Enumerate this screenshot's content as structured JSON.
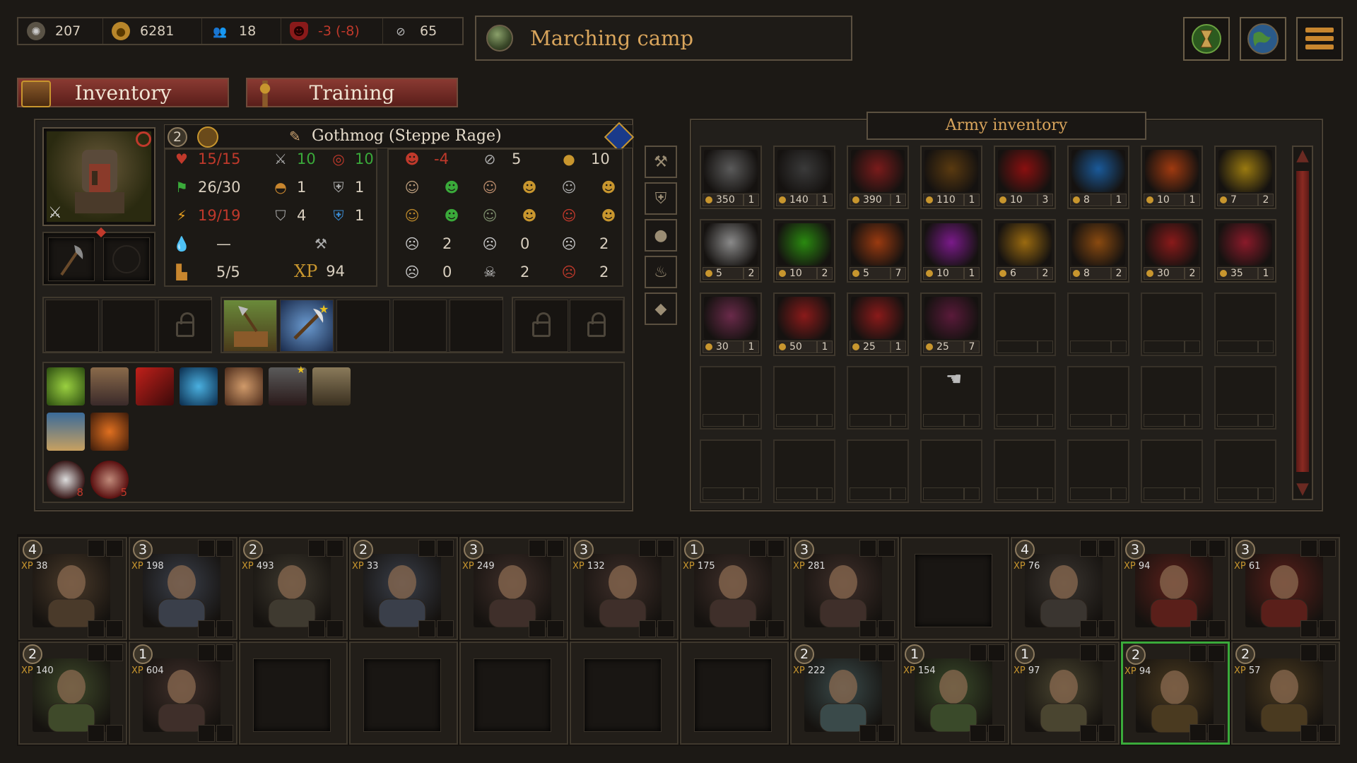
{
  "resources": [
    {
      "icon": "gear-icon",
      "value": "207",
      "color": "#d9cfbf"
    },
    {
      "icon": "gold-coins-icon",
      "value": "6281",
      "color": "#d9cfbf"
    },
    {
      "icon": "people-icon",
      "value": "18",
      "color": "#d9cfbf"
    },
    {
      "icon": "mask-icon",
      "value": "-3 (-8)",
      "color": "#c0392b"
    },
    {
      "icon": "eye-crossed-icon",
      "value": "65",
      "color": "#d9cfbf"
    }
  ],
  "location": {
    "title": "Marching camp"
  },
  "tabs": {
    "inventory": "Inventory",
    "training": "Training"
  },
  "hero": {
    "level": "2",
    "name": "Gothmog (Steppe Rage)",
    "stats": {
      "hp": "15/15",
      "attack": "10",
      "ranged": "10",
      "movement": "26/30",
      "helmet": "1",
      "armor": "1",
      "stamina": "19/19",
      "defense": "4",
      "magic_res": "1",
      "mana": "—",
      "tool": "",
      "morale_val": "5/5",
      "xp_label": "XP",
      "xp": "94"
    },
    "relations": {
      "mood": "-4",
      "hidden": "5",
      "gold": "10",
      "r1": "2",
      "r2": "0",
      "r3": "2",
      "r4": "0",
      "r5": "2",
      "r6": "2"
    }
  },
  "skills_badges": {
    "skull": "8",
    "blood": "5"
  },
  "army_inventory": {
    "title": "Army inventory",
    "items": [
      {
        "price": "350",
        "qty": "1",
        "color": "#5a5a5a",
        "icon": "gauntlet-icon"
      },
      {
        "price": "140",
        "qty": "1",
        "color": "#3a3a3a",
        "icon": "caltrops-icon"
      },
      {
        "price": "390",
        "qty": "1",
        "color": "#7a1b1b",
        "icon": "red-sword-icon"
      },
      {
        "price": "110",
        "qty": "1",
        "color": "#5a3a10",
        "icon": "amulet-icon"
      },
      {
        "price": "10",
        "qty": "3",
        "color": "#8a1010",
        "icon": "red-potion-icon"
      },
      {
        "price": "8",
        "qty": "1",
        "color": "#1a5a9a",
        "icon": "blue-vial-icon"
      },
      {
        "price": "10",
        "qty": "1",
        "color": "#a03a10",
        "icon": "fire-potion-icon"
      },
      {
        "price": "7",
        "qty": "2",
        "color": "#9a7a10",
        "icon": "yellow-flask-icon"
      },
      {
        "price": "5",
        "qty": "2",
        "color": "#8a8a8a",
        "icon": "white-flask-icon"
      },
      {
        "price": "10",
        "qty": "2",
        "color": "#2a8a10",
        "icon": "green-potion-icon"
      },
      {
        "price": "5",
        "qty": "7",
        "color": "#9a3a10",
        "icon": "orange-jar-icon"
      },
      {
        "price": "10",
        "qty": "1",
        "color": "#7a1a8a",
        "icon": "purple-potion-icon"
      },
      {
        "price": "6",
        "qty": "2",
        "color": "#9a6a10",
        "icon": "honey-jar-icon"
      },
      {
        "price": "8",
        "qty": "2",
        "color": "#8a4a10",
        "icon": "dart-icon"
      },
      {
        "price": "30",
        "qty": "2",
        "color": "#8a1a1a",
        "icon": "rune-hand-icon"
      },
      {
        "price": "35",
        "qty": "1",
        "color": "#8a1a2a",
        "icon": "rune-skull-icon"
      },
      {
        "price": "30",
        "qty": "1",
        "color": "#6a2a4a",
        "icon": "scroll-icon"
      },
      {
        "price": "50",
        "qty": "1",
        "color": "#8a1a1a",
        "icon": "rune-icon"
      },
      {
        "price": "25",
        "qty": "1",
        "color": "#8a1a1a",
        "icon": "rune-slash-icon"
      },
      {
        "price": "25",
        "qty": "7",
        "color": "#5a1a3a",
        "icon": "feather-icon"
      }
    ]
  },
  "army": [
    {
      "level": "4",
      "xp": "38",
      "color": "#4a3a2a"
    },
    {
      "level": "3",
      "xp": "198",
      "color": "#3a3f4a"
    },
    {
      "level": "2",
      "xp": "493",
      "color": "#3f3a30"
    },
    {
      "level": "2",
      "xp": "33",
      "color": "#3a3f4a"
    },
    {
      "level": "3",
      "xp": "249",
      "color": "#3f2f2a"
    },
    {
      "level": "3",
      "xp": "132",
      "color": "#3f2f2a"
    },
    {
      "level": "1",
      "xp": "175",
      "color": "#3f2f2a"
    },
    {
      "level": "3",
      "xp": "281",
      "color": "#3f2f2a"
    },
    {
      "level": "",
      "xp": "",
      "color": ""
    },
    {
      "level": "4",
      "xp": "76",
      "color": "#3a3530"
    },
    {
      "level": "3",
      "xp": "94",
      "color": "#5a1f1a"
    },
    {
      "level": "3",
      "xp": "61",
      "color": "#5a1f1a"
    },
    {
      "level": "2",
      "xp": "140",
      "color": "#3f4a2a"
    },
    {
      "level": "1",
      "xp": "604",
      "color": "#3f2f2a"
    },
    {
      "level": "",
      "xp": "",
      "color": ""
    },
    {
      "level": "",
      "xp": "",
      "color": ""
    },
    {
      "level": "",
      "xp": "",
      "color": ""
    },
    {
      "level": "",
      "xp": "",
      "color": ""
    },
    {
      "level": "",
      "xp": "",
      "color": ""
    },
    {
      "level": "2",
      "xp": "222",
      "color": "#3a4a4a"
    },
    {
      "level": "1",
      "xp": "154",
      "color": "#3a4a2a"
    },
    {
      "level": "1",
      "xp": "97",
      "color": "#4a4530"
    },
    {
      "level": "2",
      "xp": "94",
      "color": "#4a3a20",
      "selected": true
    },
    {
      "level": "2",
      "xp": "57",
      "color": "#4a3a20"
    }
  ]
}
